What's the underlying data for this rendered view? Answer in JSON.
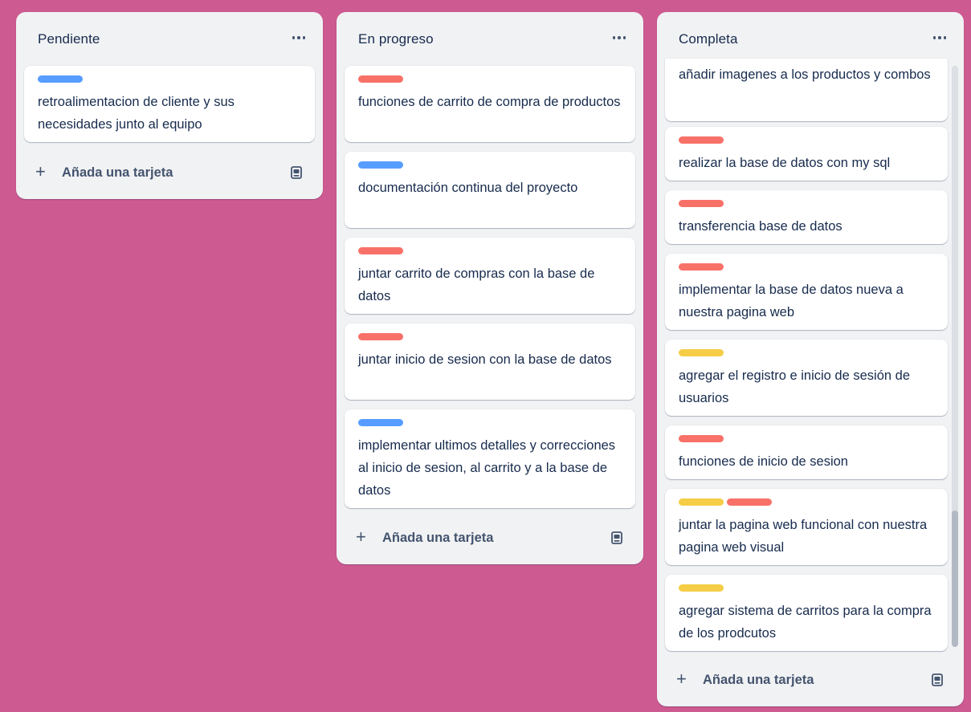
{
  "colors": {
    "background": "#cd5a91",
    "blue": "#579dff",
    "red": "#f87168",
    "yellow": "#f5cd47"
  },
  "icons": {
    "menu": "ellipsis-icon",
    "add": "plus-icon",
    "template": "card-template-icon"
  },
  "add_card_label": "Añada una tarjeta",
  "columns": [
    {
      "title": "Pendiente",
      "cards": [
        {
          "labels": [
            "blue"
          ],
          "text": "retroalimentacion de cliente y sus necesidades junto al equipo"
        }
      ]
    },
    {
      "title": "En progreso",
      "cards": [
        {
          "labels": [
            "red"
          ],
          "text": "funciones de carrito de compra de productos"
        },
        {
          "labels": [
            "blue"
          ],
          "text": "documentación continua del proyecto"
        },
        {
          "labels": [
            "red"
          ],
          "text": "juntar carrito de compras con la base de datos"
        },
        {
          "labels": [
            "red"
          ],
          "text": "juntar inicio de sesion con la base de datos"
        },
        {
          "labels": [
            "blue"
          ],
          "text": "implementar ultimos detalles y correcciones al inicio de sesion, al carrito y a la base de datos"
        }
      ]
    },
    {
      "title": "Completa",
      "cards": [
        {
          "labels": [],
          "text": "añadir imagenes a los productos y combos"
        },
        {
          "labels": [
            "red"
          ],
          "text": "realizar la base de datos con my sql"
        },
        {
          "labels": [
            "red"
          ],
          "text": "transferencia base de datos"
        },
        {
          "labels": [
            "red"
          ],
          "text": "implementar la base de datos nueva a nuestra pagina web"
        },
        {
          "labels": [
            "yellow"
          ],
          "text": "agregar el registro e inicio de sesión de usuarios"
        },
        {
          "labels": [
            "red"
          ],
          "text": "funciones de inicio de sesion"
        },
        {
          "labels": [
            "yellow",
            "red"
          ],
          "text": "juntar la pagina web funcional con nuestra pagina web visual"
        },
        {
          "labels": [
            "yellow"
          ],
          "text": "agregar sistema de carritos para la compra de los prodcutos"
        }
      ]
    }
  ]
}
